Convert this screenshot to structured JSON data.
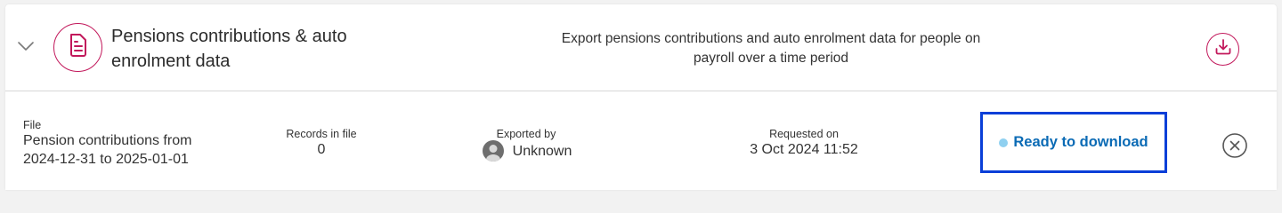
{
  "header": {
    "title": "Pensions contributions & auto enrolment data",
    "description": "Export pensions contributions and auto enrolment data for people on payroll over a time period",
    "icons": {
      "expand": "chevron-down-icon",
      "document": "document-icon",
      "download": "download-icon"
    }
  },
  "export_row": {
    "file": {
      "label": "File",
      "value_line1": "Pension contributions from",
      "value_line2": "2024-12-31 to 2025-01-01"
    },
    "records": {
      "label": "Records in file",
      "value": "0"
    },
    "exported_by": {
      "label": "Exported by",
      "value": "Unknown",
      "avatar_icon": "user-avatar-icon"
    },
    "requested_on": {
      "label": "Requested on",
      "value": "3 Oct 2024 11:52"
    },
    "status": {
      "text": "Ready to download",
      "dot_color": "#8fd0f0",
      "text_color": "#0b6bb5",
      "highlight_color": "#0a3fd8"
    },
    "remove_icon": "close-circle-icon"
  },
  "colors": {
    "accent": "#c2185b",
    "text": "#333333",
    "divider": "#d6d6d6"
  }
}
